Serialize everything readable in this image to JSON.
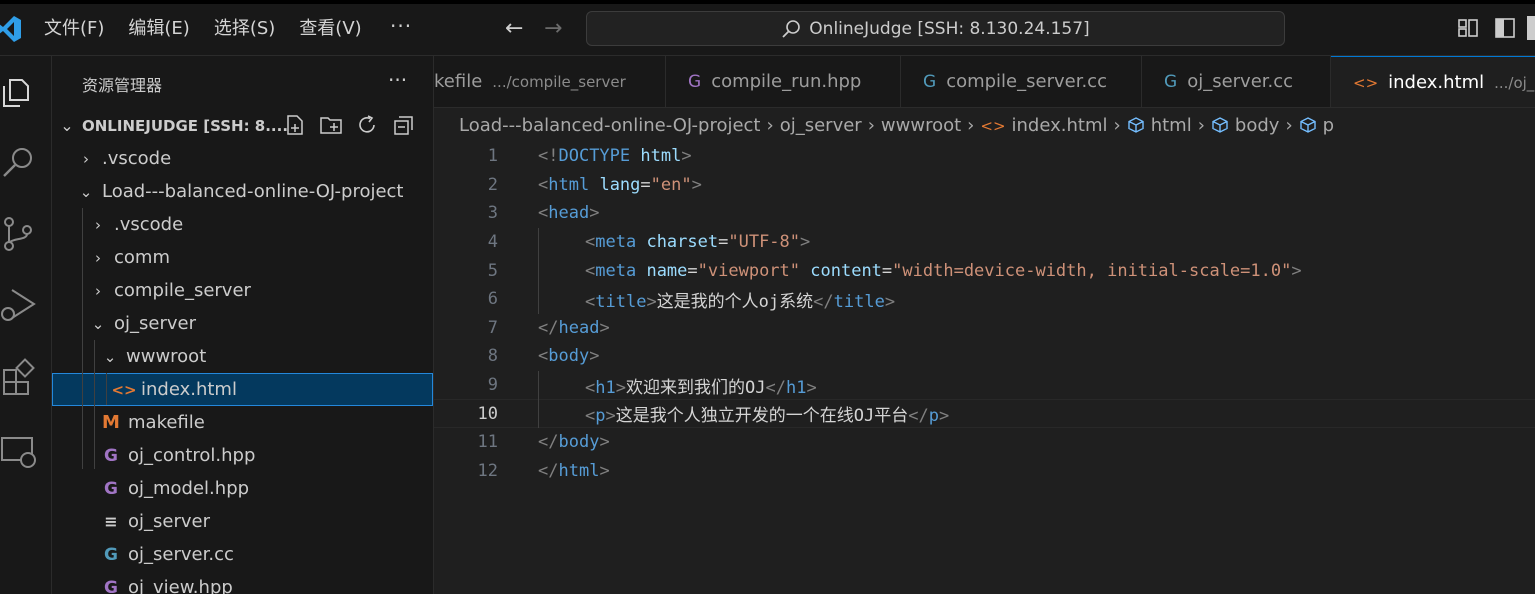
{
  "titlebar": {
    "menu": [
      "文件(F)",
      "编辑(E)",
      "选择(S)",
      "查看(V)"
    ],
    "more": "···",
    "search_text": "OnlineJudge [SSH: 8.130.24.157]"
  },
  "sidebar": {
    "title": "资源管理器",
    "more": "···",
    "section_label": "ONLINEJUDGE [SSH: 8....",
    "items": [
      {
        "label": ".vscode",
        "depth": 1,
        "kind": "folder",
        "expanded": false
      },
      {
        "label": "Load---balanced-online-OJ-project",
        "depth": 1,
        "kind": "folder",
        "expanded": true
      },
      {
        "label": ".vscode",
        "depth": 2,
        "kind": "folder",
        "expanded": false
      },
      {
        "label": "comm",
        "depth": 2,
        "kind": "folder",
        "expanded": false
      },
      {
        "label": "compile_server",
        "depth": 2,
        "kind": "folder",
        "expanded": false
      },
      {
        "label": "oj_server",
        "depth": 2,
        "kind": "folder",
        "expanded": true
      },
      {
        "label": "wwwroot",
        "depth": 3,
        "kind": "folder",
        "expanded": true
      },
      {
        "label": "index.html",
        "depth": 4,
        "kind": "html",
        "selected": true
      },
      {
        "label": "makefile",
        "depth": 3,
        "kind": "makefile"
      },
      {
        "label": "oj_control.hpp",
        "depth": 3,
        "kind": "cpp"
      },
      {
        "label": "oj_model.hpp",
        "depth": 3,
        "kind": "cpp"
      },
      {
        "label": "oj_server",
        "depth": 3,
        "kind": "text"
      },
      {
        "label": "oj_server.cc",
        "depth": 3,
        "kind": "cc"
      },
      {
        "label": "oj_view.hpp",
        "depth": 3,
        "kind": "cpp"
      }
    ]
  },
  "tabs": [
    {
      "label": "kefile",
      "desc": ".../compile_server",
      "kind": "none",
      "active": false
    },
    {
      "label": "compile_run.hpp",
      "desc": "",
      "kind": "cpp",
      "active": false
    },
    {
      "label": "compile_server.cc",
      "desc": "",
      "kind": "cc",
      "active": false
    },
    {
      "label": "oj_server.cc",
      "desc": "",
      "kind": "cc",
      "active": false
    },
    {
      "label": "index.html",
      "desc": ".../oj_se",
      "kind": "html",
      "active": true
    }
  ],
  "breadcrumb": {
    "parts": [
      "Load---balanced-online-OJ-project",
      "oj_server",
      "wwwroot",
      "index.html",
      "html",
      "body",
      "p"
    ]
  },
  "editor": {
    "current_line": 10,
    "lines": [
      {
        "n": "1",
        "indent": 0,
        "tokens": [
          [
            "p",
            "<!"
          ],
          [
            "tag",
            "DOCTYPE"
          ],
          [
            "t",
            " "
          ],
          [
            "attr",
            "html"
          ],
          [
            "p",
            ">"
          ]
        ]
      },
      {
        "n": "2",
        "indent": 0,
        "tokens": [
          [
            "p",
            "<"
          ],
          [
            "tag",
            "html"
          ],
          [
            "t",
            " "
          ],
          [
            "attr",
            "lang"
          ],
          [
            "t",
            "="
          ],
          [
            "str",
            "\"en\""
          ],
          [
            "p",
            ">"
          ]
        ]
      },
      {
        "n": "3",
        "indent": 0,
        "tokens": [
          [
            "p",
            "<"
          ],
          [
            "tag",
            "head"
          ],
          [
            "p",
            ">"
          ]
        ]
      },
      {
        "n": "4",
        "indent": 1,
        "tokens": [
          [
            "p",
            "<"
          ],
          [
            "tag",
            "meta"
          ],
          [
            "t",
            " "
          ],
          [
            "attr",
            "charset"
          ],
          [
            "t",
            "="
          ],
          [
            "str",
            "\"UTF-8\""
          ],
          [
            "p",
            ">"
          ]
        ]
      },
      {
        "n": "5",
        "indent": 1,
        "tokens": [
          [
            "p",
            "<"
          ],
          [
            "tag",
            "meta"
          ],
          [
            "t",
            " "
          ],
          [
            "attr",
            "name"
          ],
          [
            "t",
            "="
          ],
          [
            "str",
            "\"viewport\""
          ],
          [
            "t",
            " "
          ],
          [
            "attr",
            "content"
          ],
          [
            "t",
            "="
          ],
          [
            "str",
            "\"width=device-width, initial-scale=1.0\""
          ],
          [
            "p",
            ">"
          ]
        ]
      },
      {
        "n": "6",
        "indent": 1,
        "tokens": [
          [
            "p",
            "<"
          ],
          [
            "tag",
            "title"
          ],
          [
            "p",
            ">"
          ],
          [
            "t",
            "这是我的个人oj系统"
          ],
          [
            "p",
            "</"
          ],
          [
            "tag",
            "title"
          ],
          [
            "p",
            ">"
          ]
        ]
      },
      {
        "n": "7",
        "indent": 0,
        "tokens": [
          [
            "p",
            "</"
          ],
          [
            "tag",
            "head"
          ],
          [
            "p",
            ">"
          ]
        ]
      },
      {
        "n": "8",
        "indent": 0,
        "tokens": [
          [
            "p",
            "<"
          ],
          [
            "tag",
            "body"
          ],
          [
            "p",
            ">"
          ]
        ]
      },
      {
        "n": "9",
        "indent": 1,
        "tokens": [
          [
            "p",
            "<"
          ],
          [
            "tag",
            "h1"
          ],
          [
            "p",
            ">"
          ],
          [
            "t",
            "欢迎来到我们的OJ"
          ],
          [
            "p",
            "</"
          ],
          [
            "tag",
            "h1"
          ],
          [
            "p",
            ">"
          ]
        ]
      },
      {
        "n": "10",
        "indent": 1,
        "tokens": [
          [
            "p",
            "<"
          ],
          [
            "tag",
            "p"
          ],
          [
            "p",
            ">"
          ],
          [
            "t",
            "这是我个人独立开发的一个在线OJ平台"
          ],
          [
            "p",
            "</"
          ],
          [
            "tag",
            "p"
          ],
          [
            "p",
            ">"
          ]
        ]
      },
      {
        "n": "11",
        "indent": 0,
        "tokens": [
          [
            "p",
            "</"
          ],
          [
            "tag",
            "body"
          ],
          [
            "p",
            ">"
          ]
        ]
      },
      {
        "n": "12",
        "indent": 0,
        "tokens": [
          [
            "p",
            "</"
          ],
          [
            "tag",
            "html"
          ],
          [
            "p",
            ">"
          ]
        ]
      }
    ]
  },
  "colors": {
    "accent": "#0078d4",
    "selection": "#04395e",
    "html_icon": "#e37933",
    "cpp_icon": "#a074c4",
    "cc_icon": "#519aba",
    "makefile_icon": "#e37933"
  }
}
